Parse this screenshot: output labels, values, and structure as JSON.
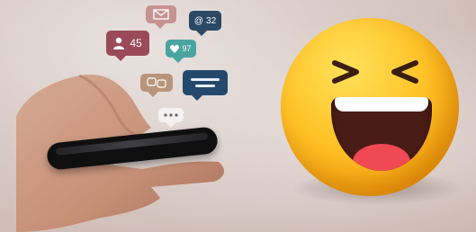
{
  "scene": {
    "notifications": {
      "followers_count": "45",
      "mentions_count": "32",
      "likes_count": "97"
    },
    "icons": [
      "user-icon",
      "mail-icon",
      "at-icon",
      "heart-icon",
      "chat-icon",
      "text-message-icon",
      "typing-dots-icon"
    ],
    "subject": "laughing-emoji",
    "colors": {
      "emoji_yellow": "#ffc227",
      "mouth_dark": "#4a1c16",
      "tongue_red": "#ef4a54",
      "bubble_red": "#9b4a5a",
      "bubble_navy": "#2b4865",
      "bubble_teal": "#4aa5a0"
    }
  }
}
